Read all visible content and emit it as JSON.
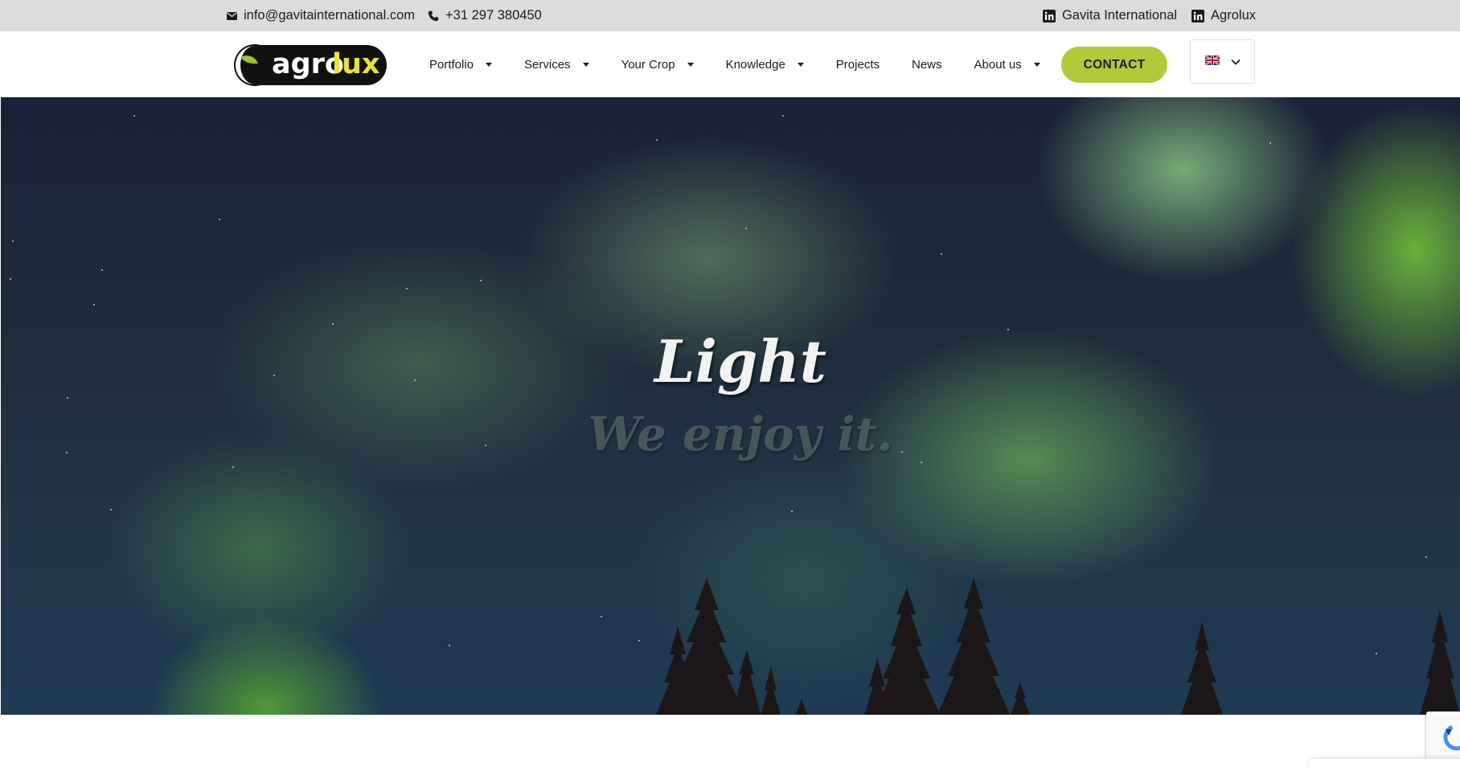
{
  "topbar": {
    "email": "info@gavitainternational.com",
    "phone": "+31 297 380450",
    "social": [
      {
        "label": "Gavita International",
        "icon": "linkedin-icon"
      },
      {
        "label": "Agrolux",
        "icon": "linkedin-icon"
      }
    ]
  },
  "header": {
    "logo": {
      "part1": "agro",
      "part2": "lux"
    },
    "nav": [
      {
        "label": "Portfolio",
        "dropdown": true
      },
      {
        "label": "Services",
        "dropdown": true
      },
      {
        "label": "Your Crop",
        "dropdown": true
      },
      {
        "label": "Knowledge",
        "dropdown": true
      },
      {
        "label": "Projects",
        "dropdown": false
      },
      {
        "label": "News",
        "dropdown": false
      },
      {
        "label": "About us",
        "dropdown": true
      }
    ],
    "contact_label": "CONTACT",
    "language": {
      "selected": "English",
      "icon": "uk-flag-icon"
    }
  },
  "hero": {
    "title": "Light",
    "subtitle": "We enjoy it."
  },
  "colors": {
    "topbar_bg": "#dcdcdc",
    "accent": "#b2c93a",
    "logo_yellow": "#e9e23a",
    "logo_leaf": "#9cc13a"
  }
}
